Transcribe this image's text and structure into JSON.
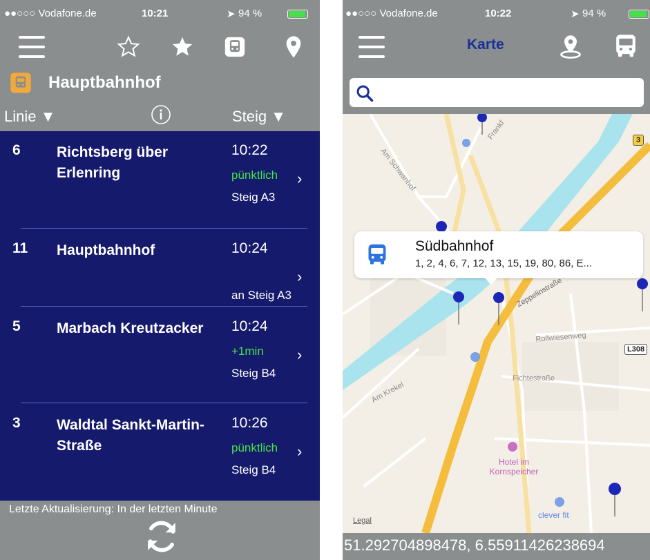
{
  "left_screen": {
    "status_bar": {
      "carrier": "●●○○○ Vodafone.de",
      "time": "10:21",
      "battery": "94 %"
    },
    "station": {
      "name": "Hauptbahnhof"
    },
    "columns": {
      "line": "Linie ▼",
      "platform": "Steig ▼"
    },
    "departures": [
      {
        "line": "6",
        "destination": "Richtsberg über Erlenring",
        "time": "10:22",
        "status": "pünktlich",
        "platform": "Steig A3"
      },
      {
        "line": "11",
        "destination": "Hauptbahnhof",
        "time": "10:24",
        "status": "",
        "platform": "an Steig A3"
      },
      {
        "line": "5",
        "destination": "Marbach Kreutzacker",
        "time": "10:24",
        "status": "+1min",
        "platform": "Steig B4"
      },
      {
        "line": "3",
        "destination": "Waldtal Sankt-Martin-Straße",
        "time": "10:26",
        "status": "pünktlich",
        "platform": "Steig B4"
      }
    ],
    "footer": {
      "last_update": "Letzte Aktualisierung: In der letzten Minute"
    }
  },
  "right_screen": {
    "status_bar": {
      "carrier": "●●○○○ Vodafone.de",
      "time": "10:22",
      "battery": "94 %"
    },
    "nav": {
      "title": "Karte"
    },
    "search": {
      "placeholder": ""
    },
    "callout": {
      "name": "Südbahnhof",
      "lines": "1, 2, 4, 6, 7, 12, 13, 15, 19, 80, 86, E..."
    },
    "map_labels": {
      "schwanhof": "Am Schwanhof",
      "frankfurter": "Frankf",
      "zeppelin": "Zeppelinstraße",
      "rollwiesen": "Rollwiesenweg",
      "fichte": "Fichtestraße",
      "krekel": "Am Krekel",
      "hotel": "Hotel im Kornspeicher",
      "fitness": "clever fit",
      "legal": "Legal",
      "road_3": "3",
      "road_l308": "L308"
    },
    "coordinates": "51.292704898478, 6.55911426238694"
  },
  "colors": {
    "toolbar_gray": "#8a8e8e",
    "departures_navy": "#151a6c",
    "status_green": "#48e248",
    "accent_orange": "#f2a93b",
    "map_blue": "#1a2f9a"
  }
}
